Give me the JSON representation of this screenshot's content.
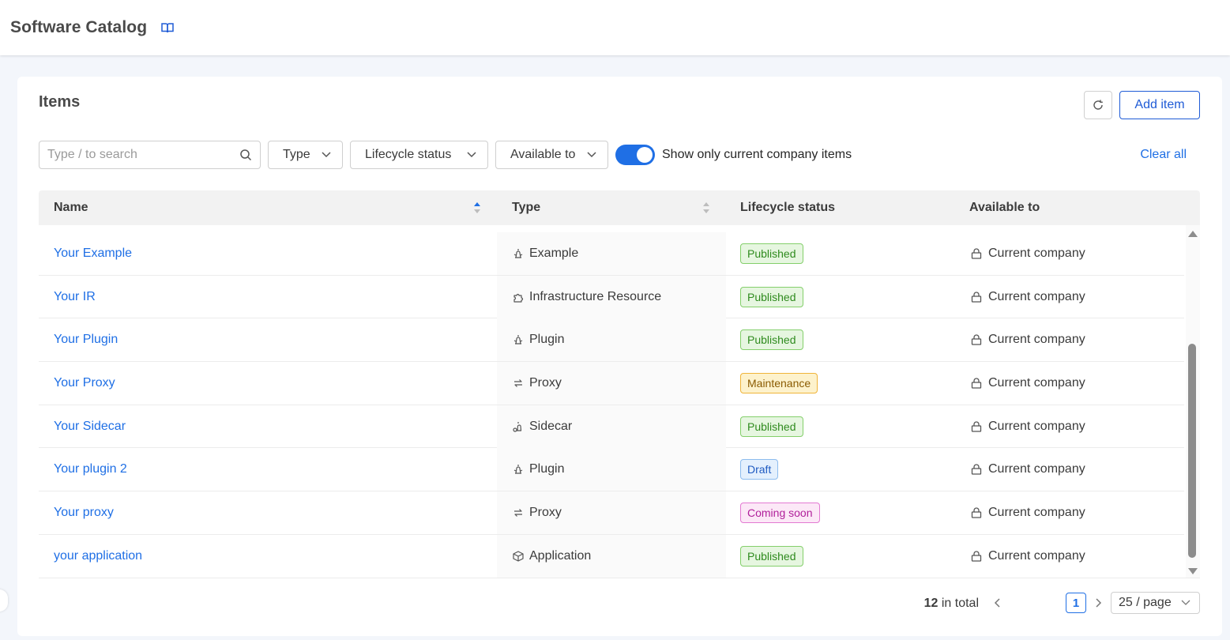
{
  "app": {
    "title": "Software Catalog",
    "book_icon": "book-open-icon"
  },
  "card": {
    "title": "Items",
    "add_label": "Add item",
    "refresh_icon": "refresh-icon"
  },
  "filters": {
    "search_placeholder": "Type / to search",
    "type_label": "Type",
    "lifecycle_label": "Lifecycle status",
    "available_label": "Available to",
    "toggle_on": true,
    "toggle_label": "Show only current company items",
    "clear_all": "Clear all"
  },
  "table": {
    "columns": {
      "name": "Name",
      "type": "Type",
      "status": "Lifecycle status",
      "available": "Available to"
    },
    "rows": [
      {
        "name": "Your Example",
        "type": "Example",
        "type_icon": "example-icon",
        "status": "Published",
        "status_kind": "published",
        "available": "Current company"
      },
      {
        "name": "Your IR",
        "type": "Infrastructure Resource",
        "type_icon": "puzzle-icon",
        "status": "Published",
        "status_kind": "published",
        "available": "Current company"
      },
      {
        "name": "Your Plugin",
        "type": "Plugin",
        "type_icon": "plugin-icon",
        "status": "Published",
        "status_kind": "published",
        "available": "Current company"
      },
      {
        "name": "Your Proxy",
        "type": "Proxy",
        "type_icon": "proxy-icon",
        "status": "Maintenance",
        "status_kind": "maintenance",
        "available": "Current company"
      },
      {
        "name": "Your Sidecar",
        "type": "Sidecar",
        "type_icon": "sidecar-icon",
        "status": "Published",
        "status_kind": "published",
        "available": "Current company"
      },
      {
        "name": "Your plugin 2",
        "type": "Plugin",
        "type_icon": "plugin-icon",
        "status": "Draft",
        "status_kind": "draft",
        "available": "Current company"
      },
      {
        "name": "Your proxy",
        "type": "Proxy",
        "type_icon": "proxy-icon",
        "status": "Coming soon",
        "status_kind": "coming",
        "available": "Current company"
      },
      {
        "name": "your application",
        "type": "Application",
        "type_icon": "cube-icon",
        "status": "Published",
        "status_kind": "published",
        "available": "Current company"
      }
    ]
  },
  "pagination": {
    "total_count": "12",
    "total_suffix": " in total",
    "current_page": "1",
    "page_size": "25 / page"
  },
  "colors": {
    "accent": "#1f6fe5",
    "published": "#2f8b1e",
    "maintenance": "#8a5a00",
    "draft": "#1f5bc2",
    "coming_soon": "#b01f9a"
  }
}
